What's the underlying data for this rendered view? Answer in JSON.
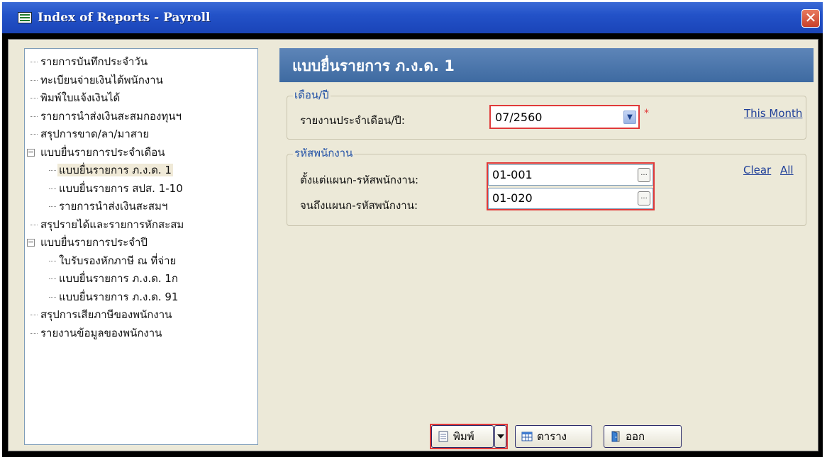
{
  "window": {
    "title": "Index of Reports - Payroll",
    "close_glyph": "✕"
  },
  "tree": {
    "items": [
      {
        "label": "รายการบันทึกประจำวัน"
      },
      {
        "label": "ทะเบียนจ่ายเงินได้พนักงาน"
      },
      {
        "label": "พิมพ์ใบแจ้งเงินได้"
      },
      {
        "label": "รายการนำส่งเงินสะสมกองทุนฯ"
      },
      {
        "label": "สรุปการขาด/ลา/มาสาย"
      },
      {
        "label": "แบบยื่นรายการประจำเดือน",
        "expander": "−"
      },
      {
        "label": "แบบยื่นรายการ ภ.ง.ด. 1"
      },
      {
        "label": "แบบยื่นรายการ สปส. 1-10"
      },
      {
        "label": "รายการนำส่งเงินสะสมฯ"
      },
      {
        "label": "สรุปรายได้และรายการหักสะสม"
      },
      {
        "label": "แบบยื่นรายการประจำปี",
        "expander": "−"
      },
      {
        "label": "ใบรับรองหักภาษี ณ ที่จ่าย"
      },
      {
        "label": "แบบยื่นรายการ ภ.ง.ด. 1ก"
      },
      {
        "label": "แบบยื่นรายการ ภ.ง.ด. 91"
      },
      {
        "label": "สรุปการเสียภาษีของพนักงาน"
      },
      {
        "label": "รายงานข้อมูลของพนักงาน"
      }
    ]
  },
  "panel": {
    "title": "แบบยื่นรายการ ภ.ง.ด. 1",
    "month_group": {
      "legend": "เดือน/ปี",
      "label": "รายงานประจำเดือน/ปี:",
      "value": "07/2560",
      "required_mark": "*",
      "this_month_link": "This Month"
    },
    "employee_group": {
      "legend": "รหัสพนักงาน",
      "from_label": "ตั้งแต่แผนก-รหัสพนักงาน:",
      "from_value": "01-001",
      "to_label": "จนถึงแผนก-รหัสพนักงาน:",
      "to_value": "01-020",
      "clear_link": "Clear",
      "all_link": "All",
      "ellipsis": "..."
    }
  },
  "buttons": {
    "print": "พิมพ์",
    "table": "ตาราง",
    "exit": "ออก"
  }
}
